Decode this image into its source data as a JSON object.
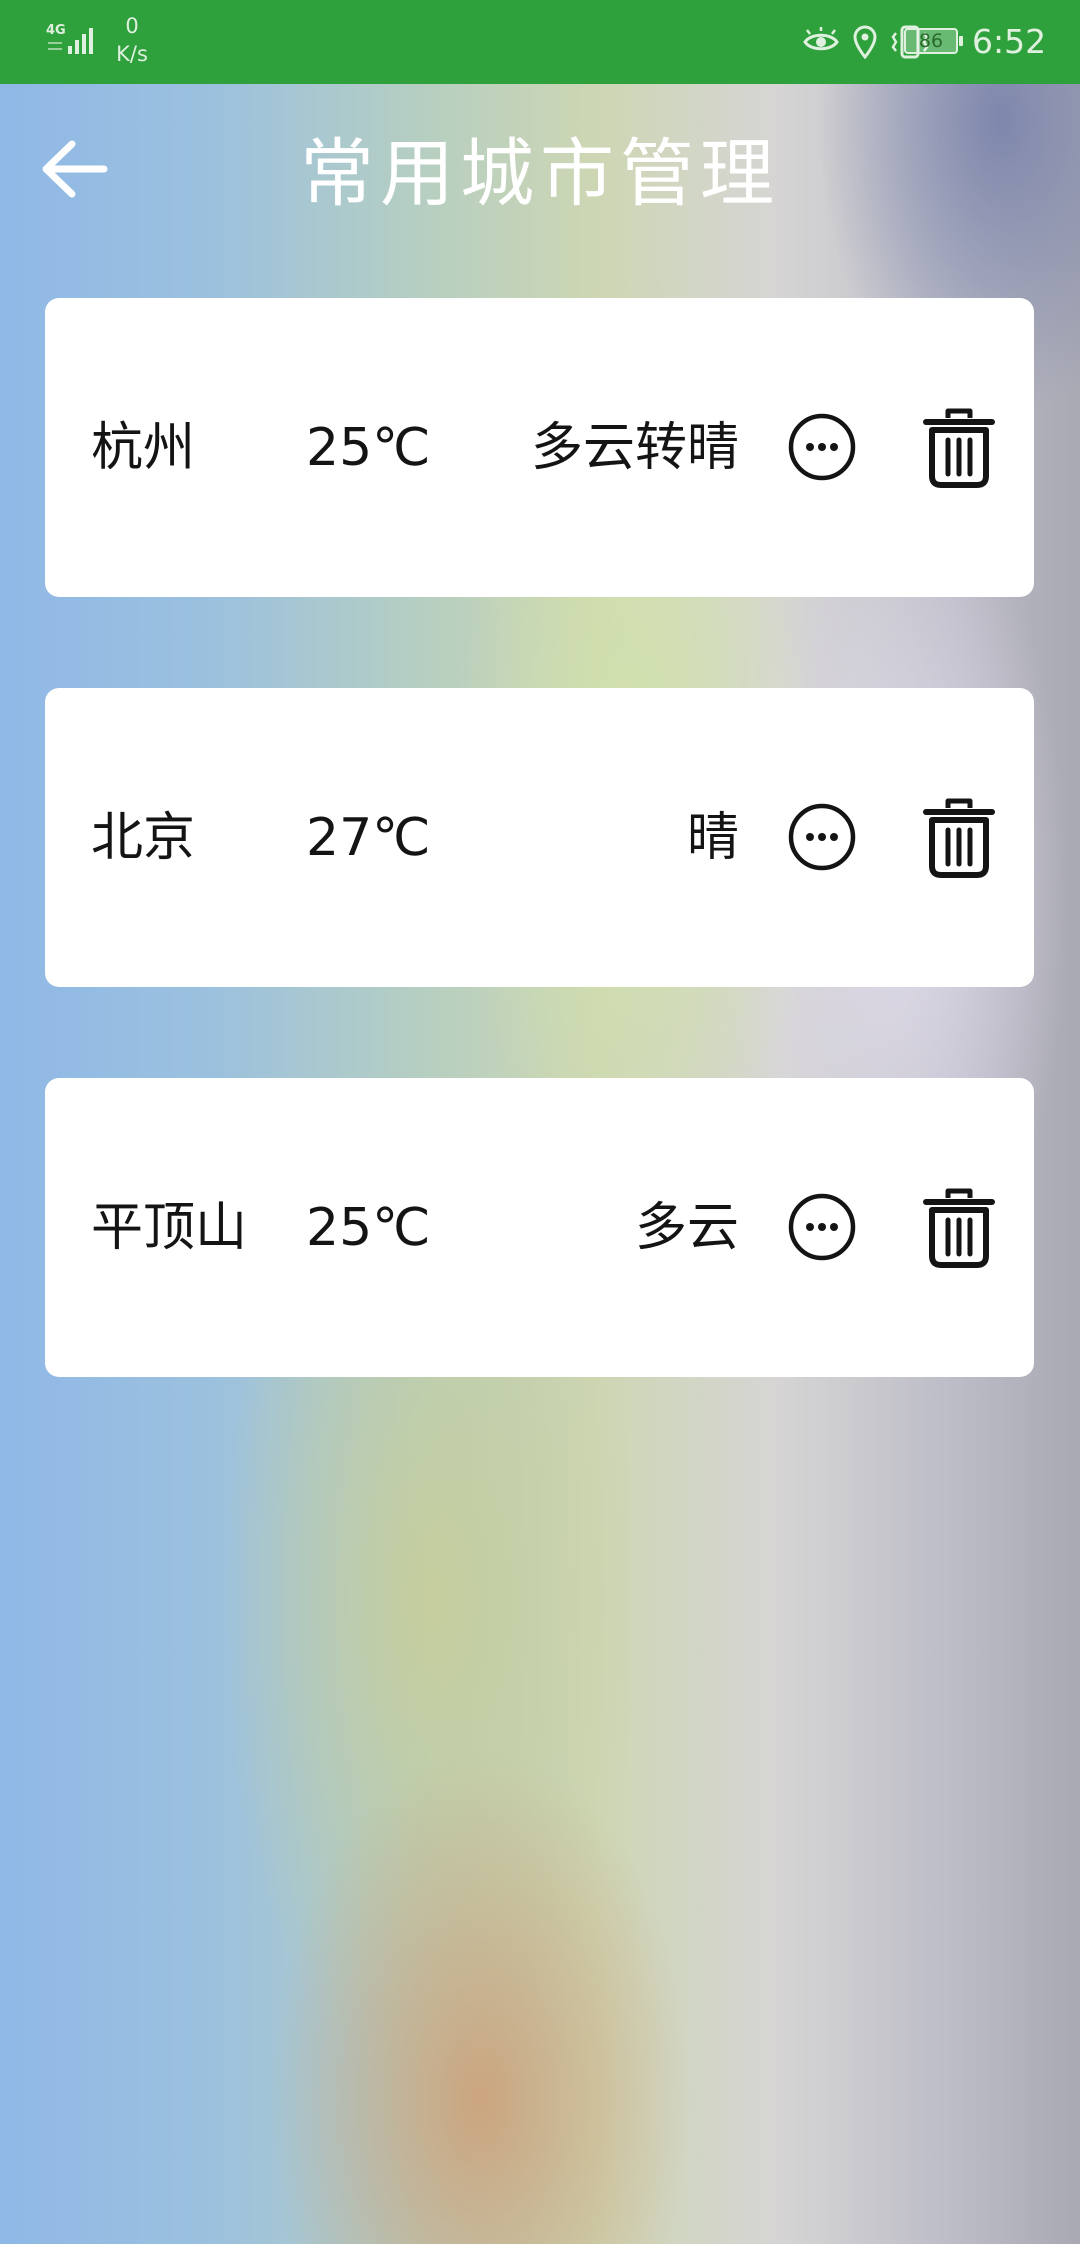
{
  "status_bar": {
    "network": "4G",
    "speed_value": "0",
    "speed_unit": "K/s",
    "battery": "86",
    "time": "6:52",
    "icons": [
      "eye-icon",
      "location-icon",
      "vibrate-icon"
    ],
    "color": "#2ea03c"
  },
  "header": {
    "back_icon": "arrow-left-icon",
    "title": "常用城市管理"
  },
  "cities": [
    {
      "name": "杭州",
      "temperature": "25℃",
      "condition": "多云转晴"
    },
    {
      "name": "北京",
      "temperature": "27℃",
      "condition": "晴"
    },
    {
      "name": "平顶山",
      "temperature": "25℃",
      "condition": "多云"
    }
  ],
  "row_icons": {
    "more": "more-options-icon",
    "delete": "trash-icon"
  }
}
